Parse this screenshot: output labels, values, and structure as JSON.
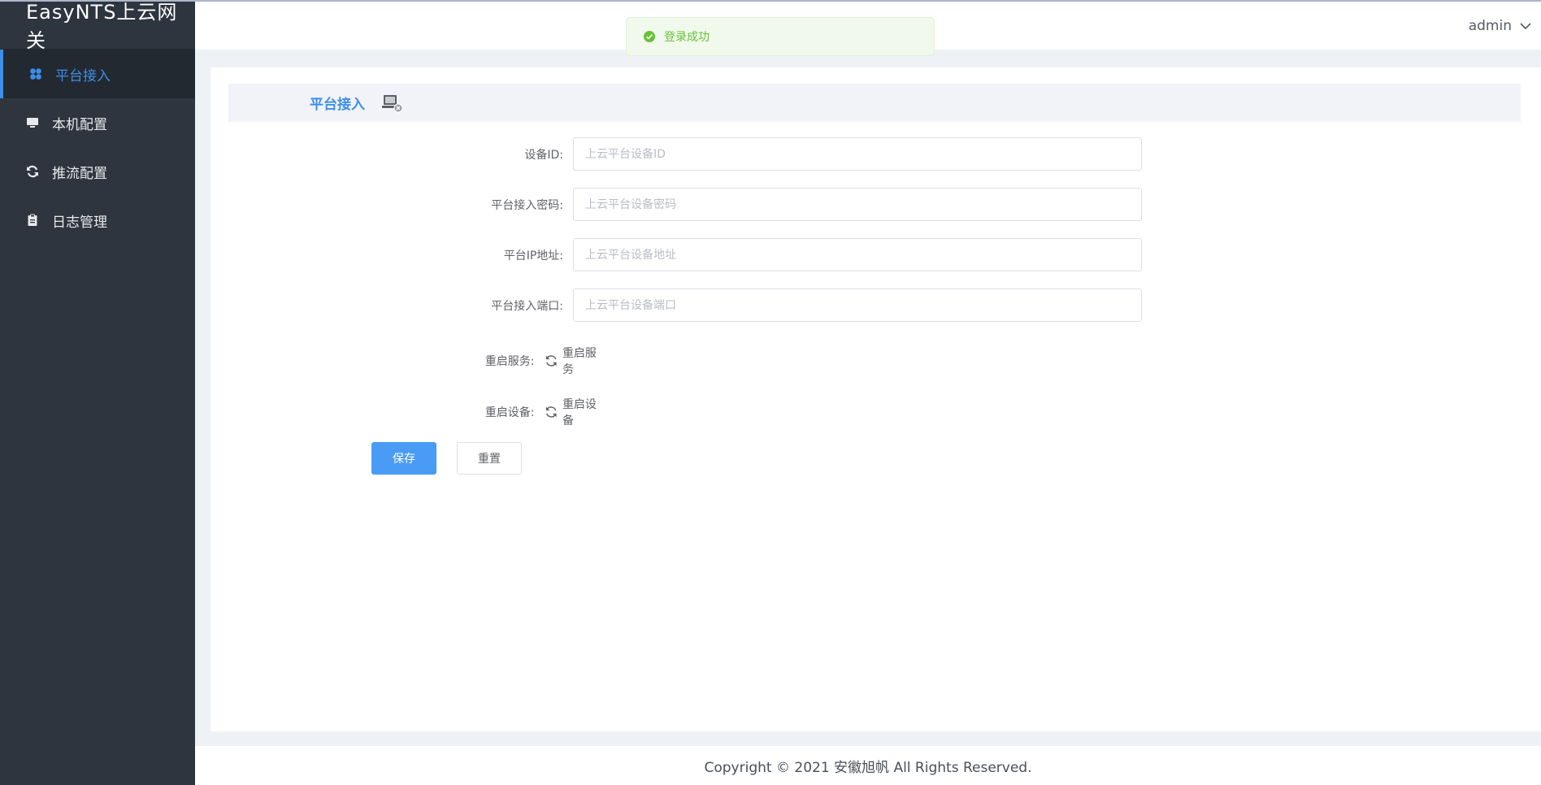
{
  "app": {
    "title": "EasyNTS上云网关"
  },
  "sidebar": {
    "items": [
      {
        "label": "平台接入",
        "icon": "cubes-icon",
        "active": true
      },
      {
        "label": "本机配置",
        "icon": "monitor-icon",
        "active": false
      },
      {
        "label": "推流配置",
        "icon": "sync-icon",
        "active": false
      },
      {
        "label": "日志管理",
        "icon": "clipboard-icon",
        "active": false
      }
    ]
  },
  "header": {
    "user": "admin"
  },
  "toast": {
    "message": "登录成功",
    "color": "#67c23a"
  },
  "section": {
    "title": "平台接入",
    "icon": "computer-status-icon"
  },
  "form": {
    "device_id": {
      "label": "设备ID:",
      "placeholder": "上云平台设备ID",
      "value": ""
    },
    "password": {
      "label": "平台接入密码:",
      "placeholder": "上云平台设备密码",
      "value": ""
    },
    "ip": {
      "label": "平台IP地址:",
      "placeholder": "上云平台设备地址",
      "value": ""
    },
    "port": {
      "label": "平台接入端口:",
      "placeholder": "上云平台设备端口",
      "value": ""
    },
    "restart_service": {
      "label": "重启服务:",
      "action": "重启服务"
    },
    "restart_device": {
      "label": "重启设备:",
      "action": "重启设备"
    },
    "save_label": "保存",
    "reset_label": "重置"
  },
  "footer": {
    "text": "Copyright © 2021 安徽旭帆 All Rights Reserved."
  },
  "colors": {
    "accent": "#3d8fe8",
    "sidebar_bg": "#2e353f",
    "primary_button": "#4a9bf5"
  }
}
